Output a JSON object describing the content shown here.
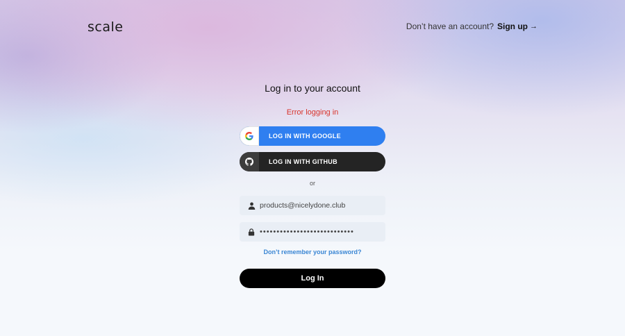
{
  "header": {
    "logo_text": "scale",
    "signup_prompt": "Don’t have an account?",
    "signup_label": "Sign up",
    "signup_arrow": "→"
  },
  "login": {
    "title": "Log in to your account",
    "error": "Error logging in",
    "google_label": "LOG IN WITH GOOGLE",
    "github_label": "LOG IN WITH GITHUB",
    "or_text": "or",
    "email_value": "products@nicelydone.club",
    "password_value": "••••••••••••••••••••••••••••",
    "forgot_label": "Don’t remember your password?",
    "submit_label": "Log In"
  },
  "icons": {
    "google": "google-icon",
    "github": "github-icon",
    "user": "user-icon",
    "lock": "lock-icon",
    "arrow": "arrow-right-icon"
  },
  "colors": {
    "google_button": "#2f7ff0",
    "github_button": "#242424",
    "error_text": "#d8332b",
    "link": "#3a86d4",
    "submit_button": "#000000"
  }
}
